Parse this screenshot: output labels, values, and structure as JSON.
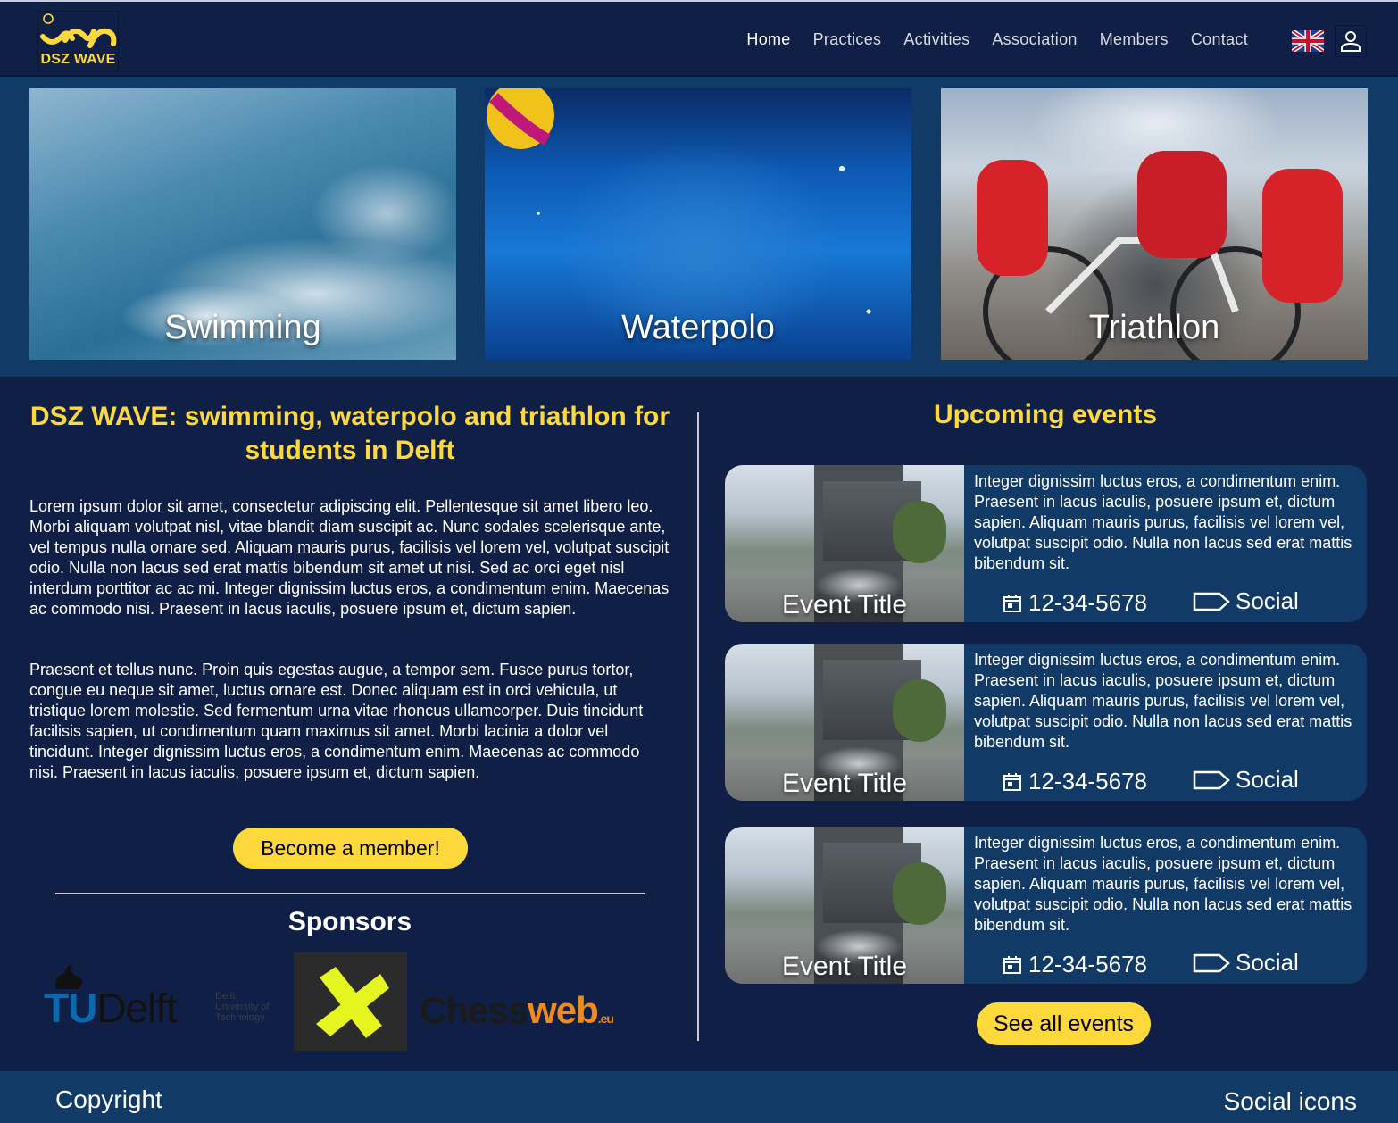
{
  "brand": {
    "logo_text": "DSZ WAVE",
    "accent": "#ffd93b",
    "background": "#0f1f45",
    "panel": "#123a67"
  },
  "nav": {
    "items": [
      {
        "label": "Home"
      },
      {
        "label": "Practices"
      },
      {
        "label": "Activities"
      },
      {
        "label": "Association"
      },
      {
        "label": "Members"
      },
      {
        "label": "Contact"
      }
    ],
    "language_icon": "uk-flag-icon",
    "account_icon": "user-icon"
  },
  "hero": {
    "cards": [
      {
        "title": "Swimming"
      },
      {
        "title": "Waterpolo"
      },
      {
        "title": "Triathlon"
      }
    ]
  },
  "intro": {
    "title": "DSZ WAVE: swimming, waterpolo and triathlon for students in Delft",
    "paragraphs": [
      "Lorem ipsum dolor sit amet, consectetur adipiscing elit. Pellentesque sit amet libero leo. Morbi aliquam volutpat nisl, vitae blandit diam suscipit ac. Nunc sodales scelerisque ante, vel tempus nulla ornare sed. Aliquam mauris purus, facilisis vel lorem vel, volutpat suscipit odio. Nulla non lacus sed erat mattis bibendum sit amet ut nisi. Sed ac orci eget nisl interdum porttitor ac ac mi. Integer dignissim luctus eros, a condimentum enim. Maecenas ac commodo nisi. Praesent in lacus iaculis, posuere ipsum et, dictum sapien.",
      "Praesent et tellus nunc. Proin quis egestas augue, a tempor sem. Fusce purus tortor, congue eu neque sit amet, luctus ornare est. Donec aliquam est in orci vehicula, ut tristique lorem molestie. Sed fermentum urna vitae rhoncus ullamcorper. Duis tincidunt facilisis sapien, ut condimentum quam maximus sit amet. Morbi lacinia a dolor vel tincidunt. Integer dignissim luctus eros, a condimentum enim. Maecenas ac commodo nisi. Praesent in lacus iaculis, posuere ipsum et, dictum sapien."
    ],
    "member_button": "Become a member!"
  },
  "sponsors": {
    "title": "Sponsors",
    "tudelft": {
      "tu": "TU",
      "delft": "Delft",
      "small": [
        "Delft",
        "University of",
        "Technology"
      ]
    },
    "chessweb": {
      "part1": "Chess",
      "part2": "web",
      "part3": ".eu"
    }
  },
  "events": {
    "title": "Upcoming events",
    "items": [
      {
        "title": "Event Title",
        "description": "Integer dignissim luctus eros, a condimentum enim. Praesent in lacus iaculis, posuere ipsum et, dictum sapien.  Aliquam mauris purus, facilisis vel lorem vel, volutpat suscipit odio. Nulla non lacus sed erat mattis bibendum sit.",
        "date": "12-34-5678",
        "tag": "Social"
      },
      {
        "title": "Event Title",
        "description": "Integer dignissim luctus eros, a condimentum enim. Praesent in lacus iaculis, posuere ipsum et, dictum sapien.  Aliquam mauris purus, facilisis vel lorem vel, volutpat suscipit odio. Nulla non lacus sed erat mattis bibendum sit.",
        "date": "12-34-5678",
        "tag": "Social"
      },
      {
        "title": "Event Title",
        "description": "Integer dignissim luctus eros, a condimentum enim. Praesent in lacus iaculis, posuere ipsum et, dictum sapien.  Aliquam mauris purus, facilisis vel lorem vel, volutpat suscipit odio. Nulla non lacus sed erat mattis bibendum sit.",
        "date": "12-34-5678",
        "tag": "Social"
      }
    ],
    "all_button": "See all events"
  },
  "footer": {
    "copyright": "Copyright",
    "social": "Social icons"
  }
}
